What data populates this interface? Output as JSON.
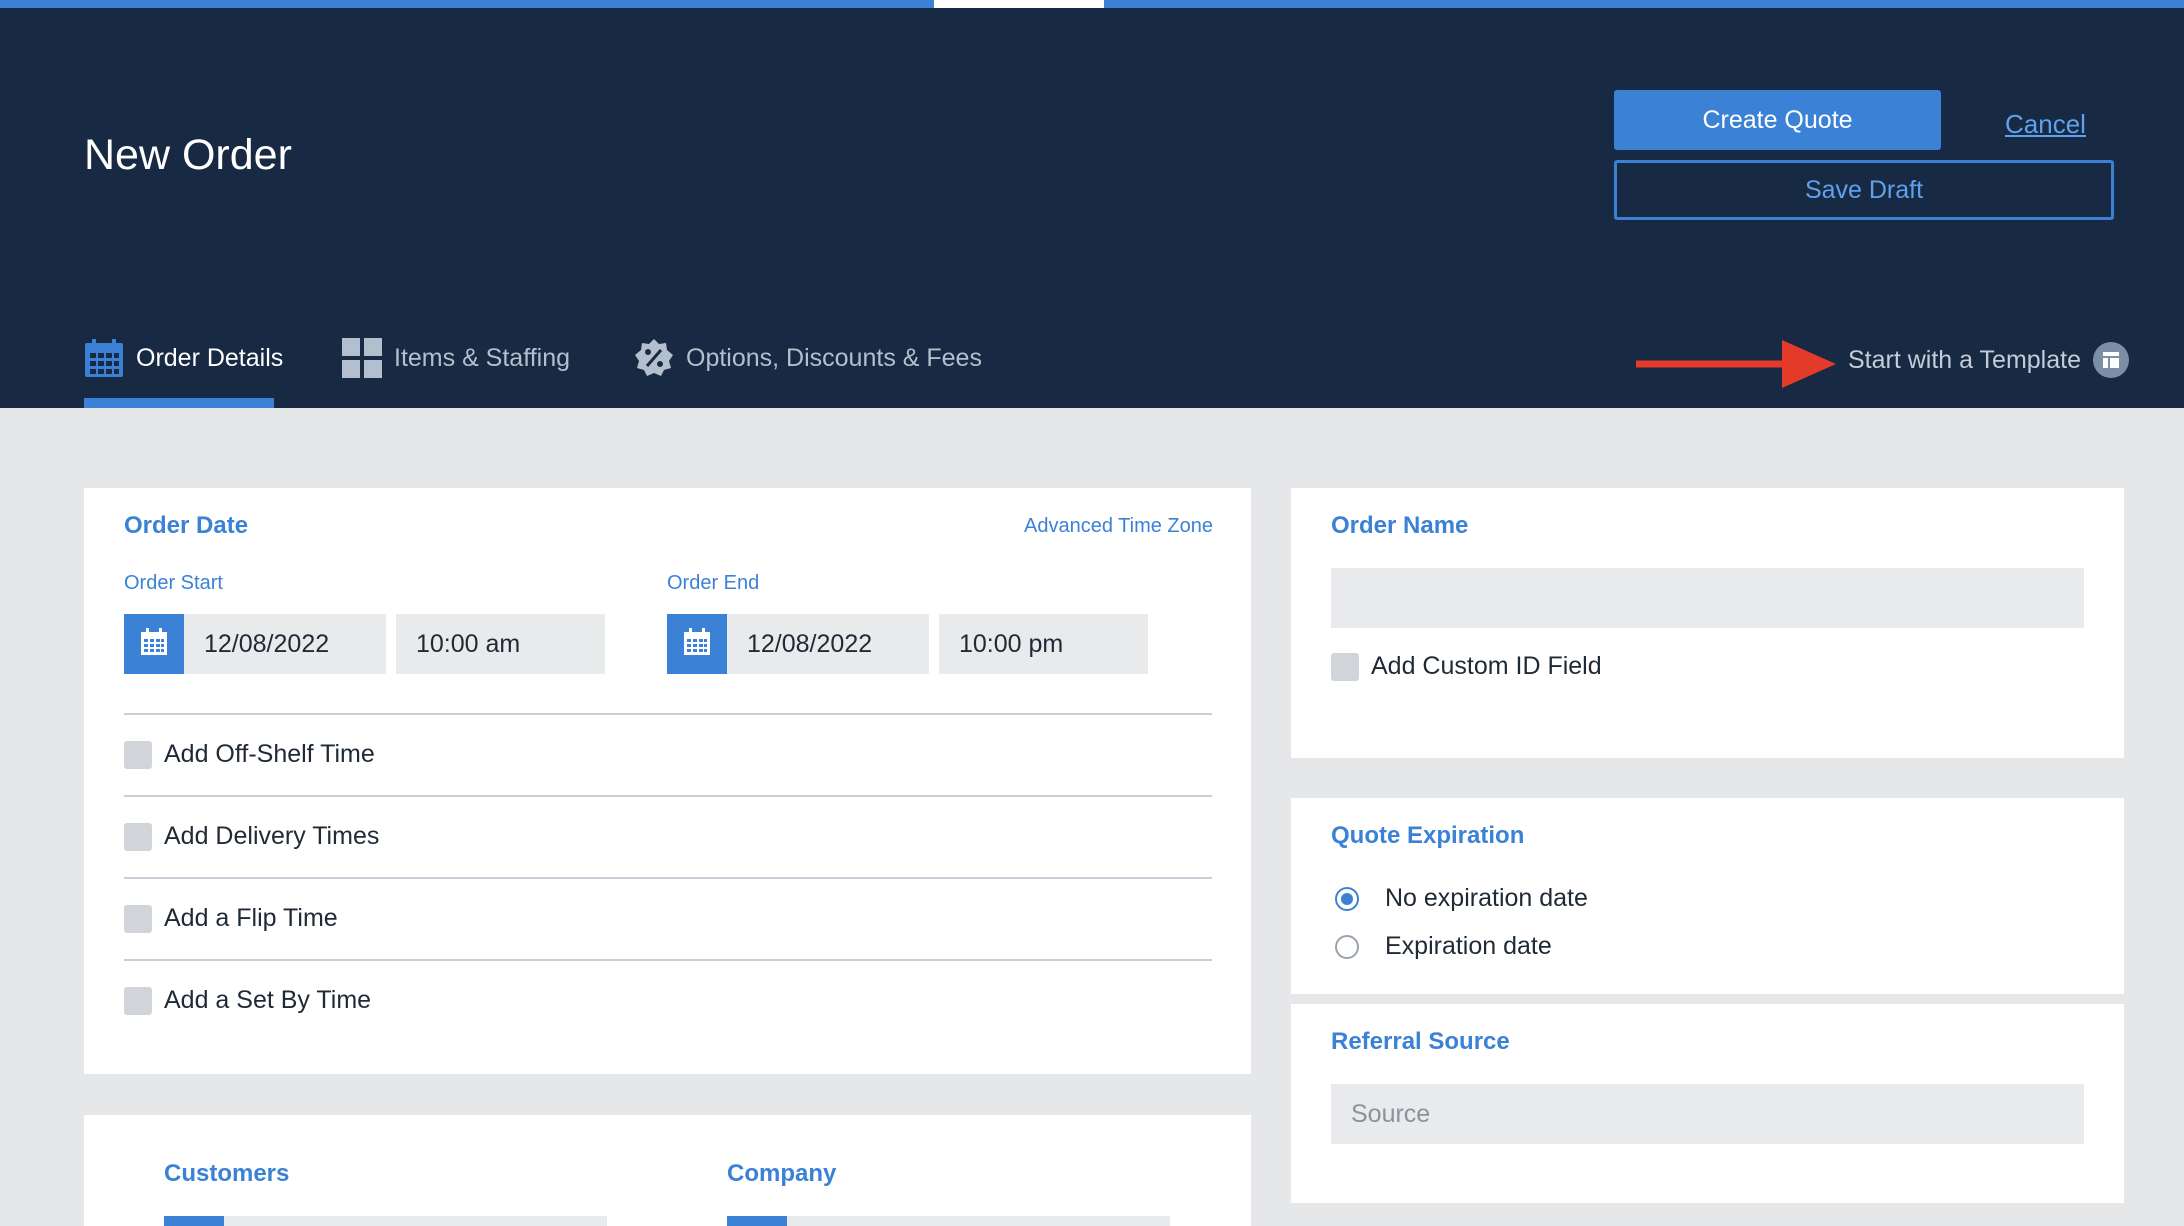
{
  "header": {
    "title": "New Order",
    "create_quote": "Create Quote",
    "cancel": "Cancel",
    "save_draft": "Save Draft"
  },
  "tabs": [
    {
      "label": "Order Details",
      "icon": "calendar-icon",
      "active": true
    },
    {
      "label": "Items & Staffing",
      "icon": "grid-icon",
      "active": false
    },
    {
      "label": "Options, Discounts & Fees",
      "icon": "discount-badge-icon",
      "active": false
    }
  ],
  "template_link": {
    "label": "Start with a Template",
    "icon": "template-icon"
  },
  "order_date": {
    "title": "Order Date",
    "advanced_tz": "Advanced Time Zone",
    "start_label": "Order Start",
    "start_date": "12/08/2022",
    "start_time": "10:00 am",
    "end_label": "Order End",
    "end_date": "12/08/2022",
    "end_time": "10:00 pm",
    "options": [
      "Add Off-Shelf Time",
      "Add Delivery Times",
      "Add a Flip Time",
      "Add a Set By Time"
    ]
  },
  "order_name": {
    "title": "Order Name",
    "value": "",
    "custom_id": "Add Custom ID Field"
  },
  "quote_expiration": {
    "title": "Quote Expiration",
    "options": [
      "No expiration date",
      "Expiration date"
    ],
    "selected": "No expiration date"
  },
  "referral": {
    "title": "Referral Source",
    "placeholder": "Source"
  },
  "customers_section": {
    "customers": "Customers",
    "company": "Company"
  },
  "colors": {
    "header_bg": "#182a43",
    "accent": "#3b82d6",
    "page_bg": "#e6e7e9"
  }
}
